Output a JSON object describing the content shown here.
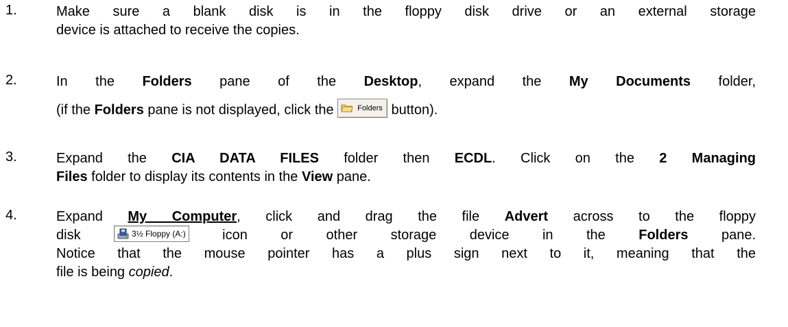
{
  "steps": [
    {
      "number": "1.",
      "lines": [
        "Make sure a blank disk is in the floppy disk drive or an external storage",
        "device is attached to receive the copies."
      ]
    },
    {
      "number": "2.",
      "l1": {
        "a": "In the ",
        "b": "Folders",
        "c": " pane of the ",
        "d": "Desktop",
        "e": ", expand the ",
        "f": "My Documents",
        "g": " folder,"
      },
      "l2": {
        "a": "(if the ",
        "b": "Folders",
        "c": " pane is not displayed, click the ",
        "btn": "Folders",
        "d": " button)."
      }
    },
    {
      "number": "3.",
      "l1": {
        "a": "Expand the ",
        "b": "CIA DATA FILES",
        "c": " folder then ",
        "d": "ECDL",
        "e": ". Click on the ",
        "f": "2 Managing"
      },
      "l2": {
        "a": "Files",
        "b": " folder to display its contents in the ",
        "c": "View",
        "d": " pane."
      }
    },
    {
      "number": "4.",
      "l1": {
        "a": "Expand ",
        "b": "My Computer",
        "c": ", click and drag the file ",
        "d": "Advert",
        "e": " across to the floppy"
      },
      "l2": {
        "a": "disk ",
        "btn": "3½ Floppy (A:)",
        "b": " icon or other storage device in the ",
        "c": "Folders",
        "d": " pane."
      },
      "l3": "Notice that the mouse pointer has a plus sign next to it, meaning that the",
      "l4": {
        "a": "file is being ",
        "b": "copied",
        "c": "."
      }
    }
  ],
  "icons": {
    "folders_button": "folder-icon",
    "floppy_button": "floppy-drive-icon"
  }
}
